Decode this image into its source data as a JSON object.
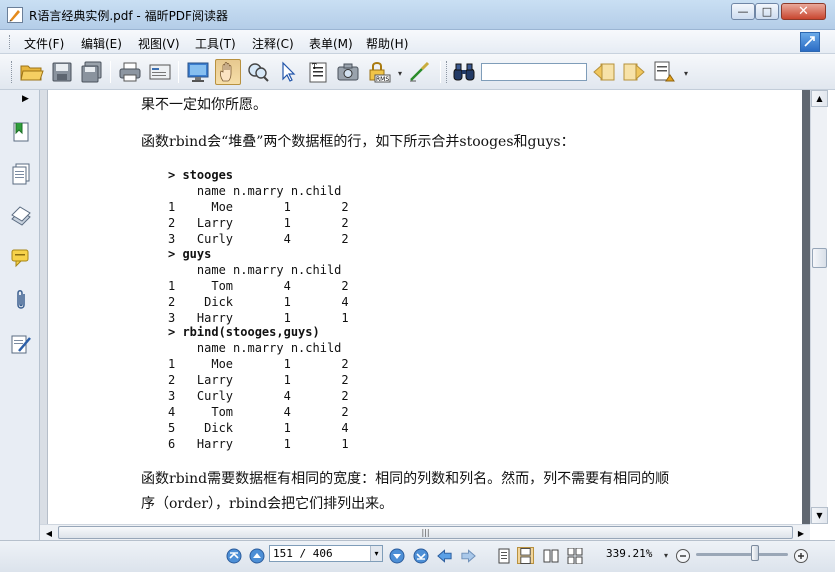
{
  "window": {
    "title": "R语言经典实例.pdf - 福昕PDF阅读器",
    "min_label": "—",
    "max_label": "□",
    "close_label": "✕"
  },
  "menu": {
    "items": [
      "文件(F)",
      "编辑(E)",
      "视图(V)",
      "工具(T)",
      "注释(C)",
      "表单(M)",
      "帮助(H)"
    ]
  },
  "toolbar": {
    "icons": [
      "open-folder-icon",
      "save-icon",
      "save-as-icon",
      "print-icon",
      "email-icon",
      "fullscreen-icon",
      "hand-icon",
      "zoom-icon",
      "select-arrow-icon",
      "text-select-icon",
      "snapshot-icon",
      "rms-lock-icon",
      "sign-icon",
      "binoculars-icon",
      "search-prev-icon",
      "search-next-icon",
      "highlight-icon"
    ],
    "search_value": ""
  },
  "left_panel": {
    "icons": [
      "bookmark-icon",
      "pages-icon",
      "layers-icon",
      "comments-icon",
      "attachments-icon",
      "signatures-icon"
    ]
  },
  "document": {
    "line1": "果不一定如你所愿。",
    "line2": "函数rbind会“堆叠”两个数据框的行，如下所示合并stooges和guys：",
    "code_blocks": [
      {
        "command": "> stooges",
        "header": "    name n.marry n.child",
        "rows": [
          "1     Moe       1       2",
          "2   Larry       1       2",
          "3   Curly       4       2"
        ]
      },
      {
        "command": "> guys",
        "header": "    name n.marry n.child",
        "rows": [
          "1     Tom       4       2",
          "2    Dick       1       4",
          "3   Harry       1       1"
        ]
      },
      {
        "command": "> rbind(stooges,guys)",
        "header": "    name n.marry n.child",
        "rows": [
          "1     Moe       1       2",
          "2   Larry       1       2",
          "3   Curly       4       2",
          "4     Tom       4       2",
          "5    Dick       1       4",
          "6   Harry       1       1"
        ]
      }
    ],
    "para1": "函数rbind需要数据框有相同的宽度：相同的列数和列名。然而，列不需要有相同的顺",
    "para2": "序（order），rbind会把它们排列出来。"
  },
  "status": {
    "page_value": "151 / 406",
    "zoom_value": "339.21%",
    "zoom_level": 0.6
  }
}
